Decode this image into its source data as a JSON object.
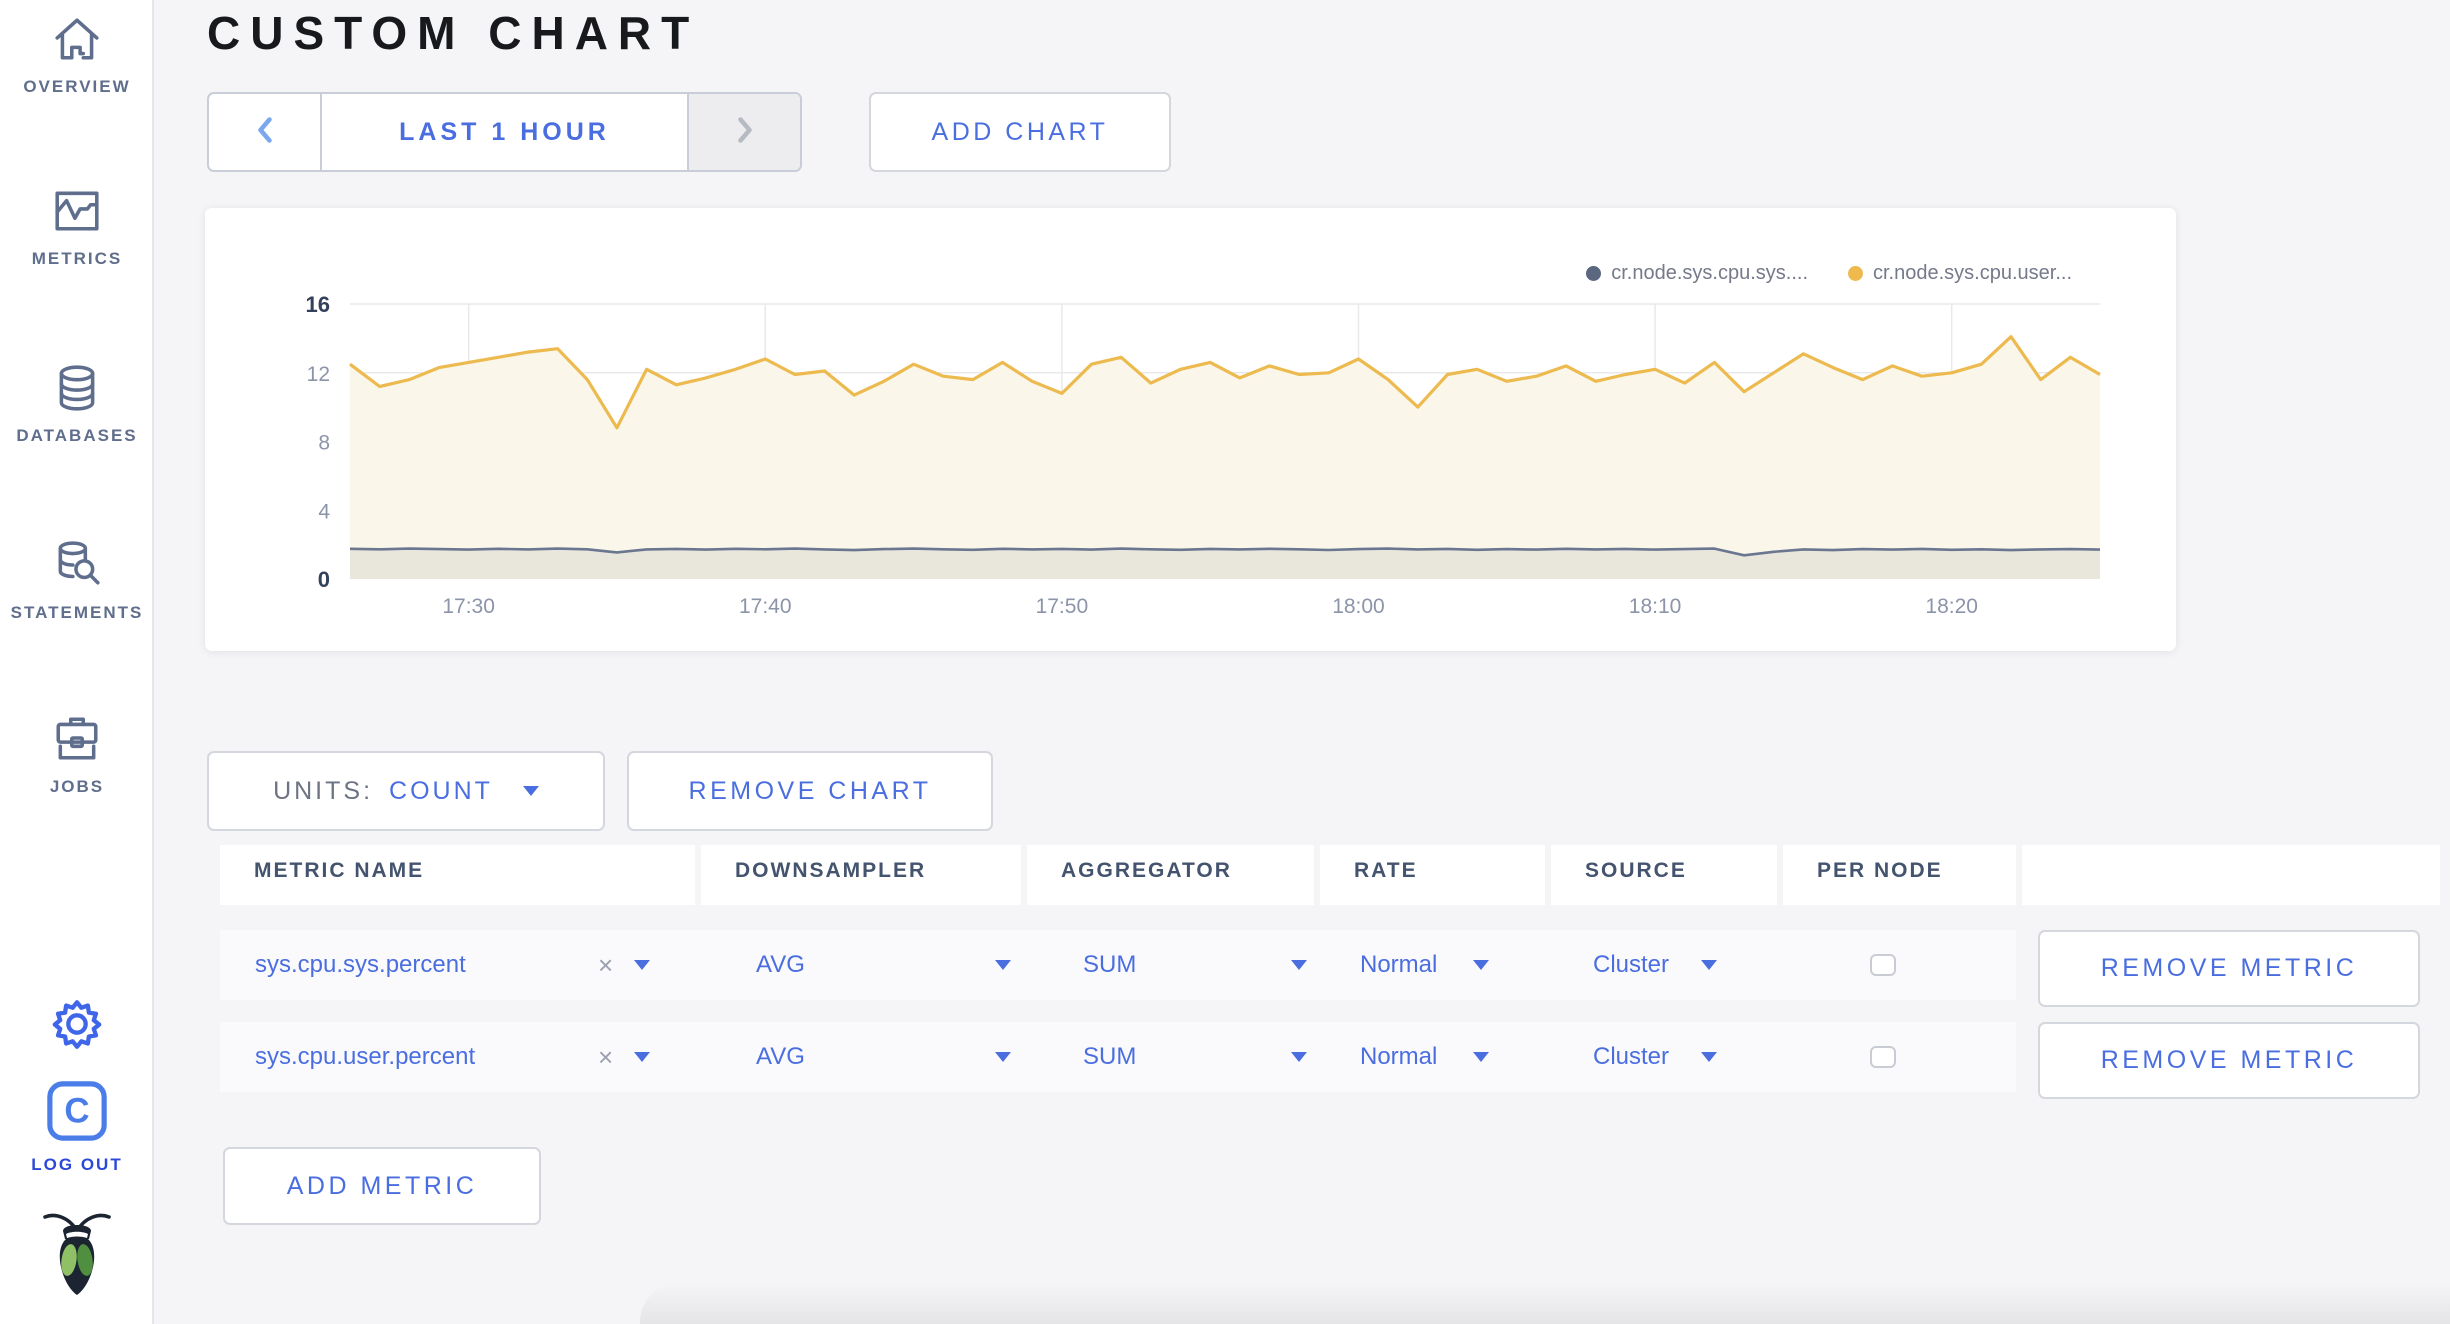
{
  "header": {
    "title": "CUSTOM CHART"
  },
  "time_selector": {
    "label": "LAST 1 HOUR"
  },
  "toolbar": {
    "add_chart_label": "ADD CHART",
    "remove_chart_label": "REMOVE CHART",
    "add_metric_label": "ADD METRIC"
  },
  "units": {
    "label": "UNITS:",
    "value": "COUNT"
  },
  "sidebar": {
    "items": [
      {
        "label": "OVERVIEW",
        "icon": "home-icon"
      },
      {
        "label": "METRICS",
        "icon": "metrics-graph-icon"
      },
      {
        "label": "DATABASES",
        "icon": "database-icon"
      },
      {
        "label": "STATEMENTS",
        "icon": "database-search-icon"
      },
      {
        "label": "JOBS",
        "icon": "briefcase-icon"
      }
    ],
    "logout_label": "LOG OUT"
  },
  "chart_data": {
    "type": "line",
    "title": "",
    "xlabel": "",
    "ylabel": "",
    "ylim": [
      0,
      16
    ],
    "yticks": [
      0,
      4,
      8,
      12,
      16
    ],
    "duration_min": 59,
    "xticks": [
      {
        "label": "17:30",
        "offset": 4
      },
      {
        "label": "17:40",
        "offset": 14
      },
      {
        "label": "17:50",
        "offset": 24
      },
      {
        "label": "18:00",
        "offset": 34
      },
      {
        "label": "18:10",
        "offset": 44
      },
      {
        "label": "18:20",
        "offset": 54
      }
    ],
    "grid": true,
    "legend_position": "top-right",
    "legend": [
      {
        "name": "cr.node.sys.cpu.sys....",
        "color": "#5b677f"
      },
      {
        "name": "cr.node.sys.cpu.user...",
        "color": "#eeba4d"
      }
    ],
    "series": [
      {
        "name": "cr.node.sys.cpu.sys....",
        "color": "#6b7790",
        "fill": "#e9e6dc",
        "values": [
          1.76,
          1.73,
          1.77,
          1.74,
          1.71,
          1.76,
          1.72,
          1.77,
          1.73,
          1.55,
          1.72,
          1.75,
          1.71,
          1.76,
          1.73,
          1.77,
          1.72,
          1.68,
          1.74,
          1.77,
          1.73,
          1.7,
          1.76,
          1.72,
          1.75,
          1.71,
          1.77,
          1.73,
          1.7,
          1.75,
          1.72,
          1.76,
          1.73,
          1.69,
          1.74,
          1.77,
          1.72,
          1.75,
          1.7,
          1.74,
          1.71,
          1.76,
          1.72,
          1.75,
          1.71,
          1.74,
          1.77,
          1.38,
          1.58,
          1.72,
          1.68,
          1.74,
          1.71,
          1.75,
          1.7,
          1.73,
          1.68,
          1.72,
          1.74,
          1.71
        ]
      },
      {
        "name": "cr.node.sys.cpu.user...",
        "color": "#ecba4e",
        "fill": "#faf6e9",
        "values": [
          12.5,
          11.2,
          11.6,
          12.3,
          12.6,
          12.9,
          13.2,
          13.4,
          11.6,
          8.8,
          12.2,
          11.3,
          11.7,
          12.2,
          12.8,
          11.9,
          12.1,
          10.7,
          11.5,
          12.5,
          11.8,
          11.6,
          12.6,
          11.5,
          10.8,
          12.5,
          12.9,
          11.4,
          12.2,
          12.6,
          11.7,
          12.4,
          11.9,
          12.0,
          12.8,
          11.6,
          10.0,
          11.9,
          12.2,
          11.5,
          11.8,
          12.4,
          11.5,
          11.9,
          12.2,
          11.4,
          12.6,
          10.9,
          12.0,
          13.1,
          12.3,
          11.6,
          12.4,
          11.8,
          12.0,
          12.5,
          14.1,
          11.6,
          12.9,
          11.9
        ]
      }
    ]
  },
  "metrics_table": {
    "columns": [
      "METRIC NAME",
      "DOWNSAMPLER",
      "AGGREGATOR",
      "RATE",
      "SOURCE",
      "PER NODE",
      ""
    ],
    "rows": [
      {
        "metric": "sys.cpu.sys.percent",
        "clear": "×",
        "downsampler": "AVG",
        "aggregator": "SUM",
        "rate": "Normal",
        "source": "Cluster",
        "per_node_checked": false,
        "remove_label": "REMOVE METRIC"
      },
      {
        "metric": "sys.cpu.user.percent",
        "clear": "×",
        "downsampler": "AVG",
        "aggregator": "SUM",
        "rate": "Normal",
        "source": "Cluster",
        "per_node_checked": false,
        "remove_label": "REMOVE METRIC"
      }
    ]
  },
  "colors": {
    "accent_blue": "#4a6ee0",
    "chevron_light_blue": "#7aa7ee",
    "sidebar_slate": "#5f6e8c",
    "yellow_line": "#ecba4e",
    "yellow_fill": "#faf6e9",
    "dark_line": "#6b7790",
    "dark_fill": "#e9e6dc",
    "page_bg": "#f5f5f7",
    "grid": "#e9e9eb",
    "axis_gray": "#8b94a8",
    "axis_dark": "#33415c",
    "gear_blue": "#3f66e8",
    "logout_blue": "#2b48d8",
    "bug_dark": "#1b2430",
    "leaf_light": "#8fc065",
    "leaf_dark": "#4f8f3f"
  }
}
